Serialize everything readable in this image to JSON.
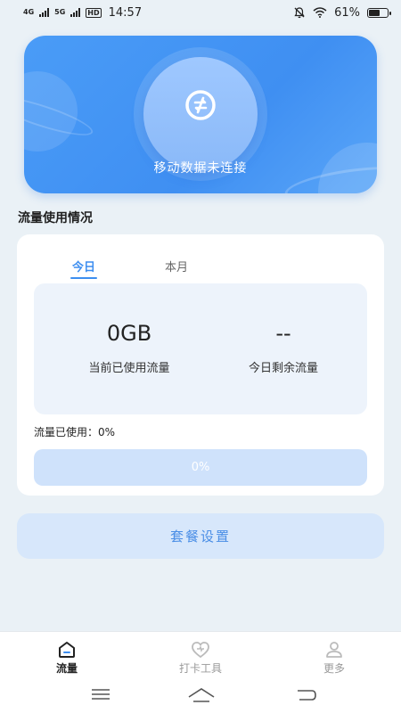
{
  "status_bar": {
    "signal_1": "4G",
    "signal_2": "5G",
    "hd": "HD",
    "time": "14:57",
    "battery": "61%",
    "battery_level": 0.61
  },
  "hero": {
    "status_text": "移动数据未连接"
  },
  "section": {
    "title": "流量使用情况"
  },
  "usage": {
    "tabs": [
      "今日",
      "本月"
    ],
    "current_used_value": "0GB",
    "current_used_label": "当前已使用流量",
    "remaining_value": "--",
    "remaining_label": "今日剩余流量",
    "used_line": "流量已使用：0%",
    "progress_text": "0%",
    "progress_fraction": 0
  },
  "plan_button": {
    "label": "套餐设置"
  },
  "bottom_nav": {
    "items": [
      "流量",
      "打卡工具",
      "更多"
    ]
  },
  "colors": {
    "accent": "#3d8ef0",
    "hero": "#4a9cf7",
    "background": "#eaf1f6"
  }
}
